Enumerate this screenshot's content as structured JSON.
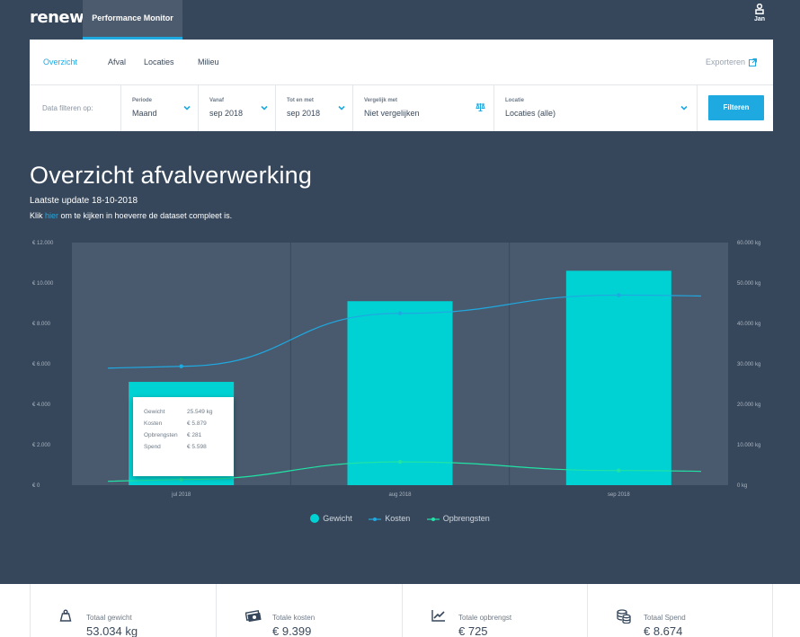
{
  "header": {
    "logo_text": "renewi",
    "app_tab_label": "Performance Monitor",
    "user_name": "Jan"
  },
  "nav": {
    "tabs": [
      {
        "label": "Overzicht",
        "active": true
      },
      {
        "label": "Afval",
        "active": false
      },
      {
        "label": "Locaties",
        "active": false
      },
      {
        "label": "Milieu",
        "active": false
      }
    ],
    "export_label": "Exporteren"
  },
  "filters": {
    "intro_label": "Data filteren op:",
    "periode": {
      "label": "Periode",
      "value": "Maand"
    },
    "vanaf": {
      "label": "Vanaf",
      "value": "sep 2018"
    },
    "tot_en_met": {
      "label": "Tot en met",
      "value": "sep 2018"
    },
    "vergelijk": {
      "label": "Vergelijk met",
      "value": "Niet vergelijken"
    },
    "locatie": {
      "label": "Locatie",
      "value": "Locaties (alle)"
    },
    "submit_label": "Filteren"
  },
  "page": {
    "title": "Overzicht afvalverwerking",
    "last_update": "Laatste update 18-10-2018",
    "complete_prefix": "Klik ",
    "complete_link": "hier",
    "complete_suffix": " om te kijken in hoeverre de dataset compleet is."
  },
  "chart_data": {
    "type": "bar",
    "categories": [
      "jul 2018",
      "aug 2018",
      "sep 2018"
    ],
    "series": [
      {
        "name": "Gewicht",
        "kind": "bar",
        "axis": "right",
        "values": [
          25549,
          45500,
          53034
        ]
      },
      {
        "name": "Kosten",
        "kind": "line",
        "axis": "left",
        "values": [
          5879,
          8500,
          9399
        ]
      },
      {
        "name": "Opbrengsten",
        "kind": "line",
        "axis": "left",
        "values": [
          281,
          1150,
          725
        ]
      }
    ],
    "left_axis": {
      "ticks": [
        "€ 0",
        "€ 2.000",
        "€ 4.000",
        "€ 6.000",
        "€ 8.000",
        "€ 10.000",
        "€ 12.000"
      ],
      "ylim": [
        0,
        12000
      ]
    },
    "right_axis": {
      "ticks": [
        "0 kg",
        "10.000 kg",
        "20.000 kg",
        "30.000 kg",
        "40.000 kg",
        "50.000 kg",
        "60.000 kg"
      ],
      "ylim": [
        0,
        60000
      ]
    },
    "legend_position": "bottom",
    "colors": {
      "Gewicht": "#00d2d3",
      "Kosten": "#1fa9e1",
      "Opbrengsten": "#20e3a6"
    }
  },
  "tooltip": {
    "rows": [
      {
        "key": "Gewicht",
        "value": "25.549 kg"
      },
      {
        "key": "Kosten",
        "value": "€ 5.879"
      },
      {
        "key": "Opbrengsten",
        "value": "€ 281"
      },
      {
        "key": "Spend",
        "value": "€ 5.598"
      }
    ]
  },
  "summary": [
    {
      "icon": "weight-icon",
      "label": "Totaal gewicht",
      "value": "53.034 kg"
    },
    {
      "icon": "money-icon",
      "label": "Totale kosten",
      "value": "€ 9.399"
    },
    {
      "icon": "trend-chart-icon",
      "label": "Totale opbrengst",
      "value": "€ 725"
    },
    {
      "icon": "coins-icon",
      "label": "Totaal Spend",
      "value": "€ 8.674"
    }
  ],
  "colors": {
    "background": "#36475b",
    "accent": "#1fa9e1",
    "bar": "#00d2d3",
    "revenue": "#20e3a6"
  }
}
